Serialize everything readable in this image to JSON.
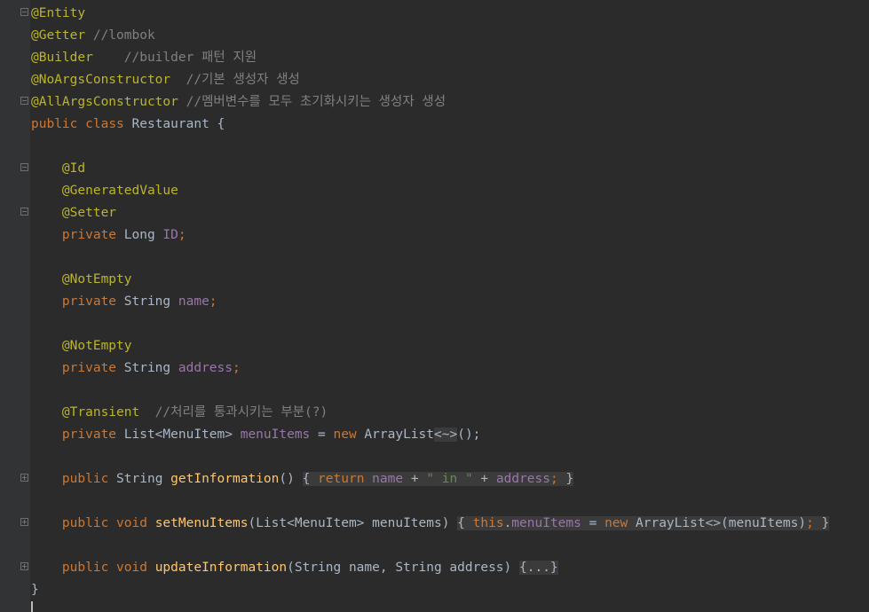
{
  "editor": {
    "lines": {
      "l1_ann": "@Entity",
      "l2_ann": "@Getter",
      "l2_cmt": " //lombok",
      "l3_ann": "@Builder",
      "l3_cmt": "    //builder 패턴 지원",
      "l4_ann": "@NoArgsConstructor",
      "l4_cmt": "  //기본 생성자 생성",
      "l5_ann": "@AllArgsConstructor",
      "l5_cmt": " //멤버변수를 모두 초기화시키는 생성자 생성",
      "l6_kw1": "public",
      "l6_kw2": "class",
      "l6_rest": " Restaurant {",
      "l8_ann": "@Id",
      "l9_ann": "@GeneratedValue",
      "l10_ann": "@Setter",
      "l11_kw": "private",
      "l11_type": " Long ",
      "l11_fld": "ID",
      "l11_semi": ";",
      "l13_ann": "@NotEmpty",
      "l14_kw": "private",
      "l14_type": " String ",
      "l14_fld": "name",
      "l14_semi": ";",
      "l16_ann": "@NotEmpty",
      "l17_kw": "private",
      "l17_type": " String ",
      "l17_fld": "address",
      "l17_semi": ";",
      "l19_ann": "@Transient",
      "l19_cmt": "  //처리를 통과시키는 부분(?)",
      "l20_kw": "private",
      "l20_type": " List<MenuItem> ",
      "l20_fld": "menuItems",
      "l20_eq": " = ",
      "l20_new": "new",
      "l20_cls": " ArrayList",
      "l20_diamond": "<~>",
      "l20_end": "();",
      "l22_kw": "public",
      "l22_type": " String ",
      "l22_fn": "getInformation",
      "l22_parens": "() ",
      "l22_open": "{ ",
      "l22_ret": "return",
      "l22_sp1": " ",
      "l22_f1": "name",
      "l22_plus1": " + ",
      "l22_str": "\" in \"",
      "l22_plus2": " + ",
      "l22_f2": "address",
      "l22_semi": ";",
      "l22_close": " }",
      "l24_kw1": "public",
      "l24_kw2": " void",
      "l24_sp": " ",
      "l24_fn": "setMenuItems",
      "l24_params": "(List<MenuItem> menuItems) ",
      "l24_open": "{ ",
      "l24_this": "this",
      "l24_dot": ".",
      "l24_fld": "menuItems",
      "l24_eq": " = ",
      "l24_new": "new",
      "l24_rest": " ArrayList<>(menuItems)",
      "l24_semi": ";",
      "l24_close": " }",
      "l26_kw1": "public",
      "l26_kw2": " void",
      "l26_sp": " ",
      "l26_fn": "updateInformation",
      "l26_params": "(String name, String address) ",
      "l26_fold": "{...}",
      "l27_close": "}"
    }
  },
  "colors": {
    "background": "#2b2b2b",
    "annotation": "#bbb529",
    "keyword": "#cc7832",
    "comment": "#808080",
    "field": "#9876aa",
    "method": "#ffc66d",
    "string": "#6a8759",
    "text": "#a9b7c6"
  }
}
